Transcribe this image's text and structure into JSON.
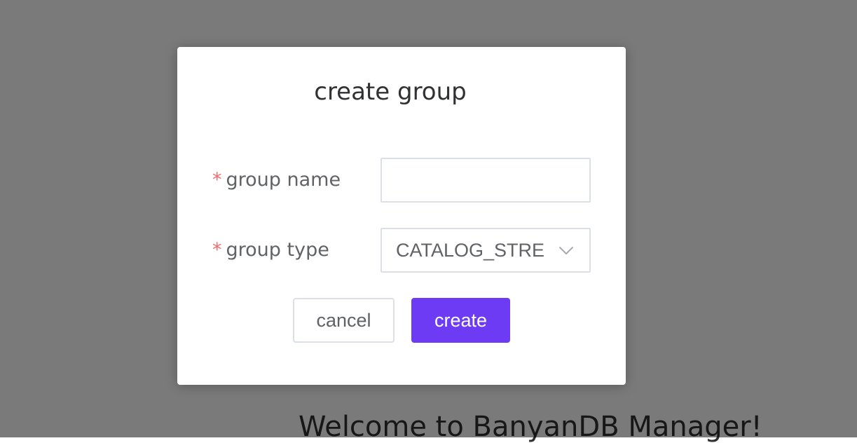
{
  "background": {
    "welcome_text": "Welcome to BanyanDB Manager!"
  },
  "dialog": {
    "title": "create group",
    "fields": {
      "group_name": {
        "required_mark": "*",
        "label": "group name",
        "value": "",
        "placeholder": ""
      },
      "group_type": {
        "required_mark": "*",
        "label": "group type",
        "selected": "CATALOG_STREAM"
      }
    },
    "buttons": {
      "cancel_label": "cancel",
      "create_label": "create"
    }
  },
  "colors": {
    "accent": "#6e3bf5",
    "required": "#f56c6c",
    "overlay": "rgba(0,0,0,0.52)"
  },
  "icons": {
    "select_arrow": "chevron-down-icon"
  }
}
